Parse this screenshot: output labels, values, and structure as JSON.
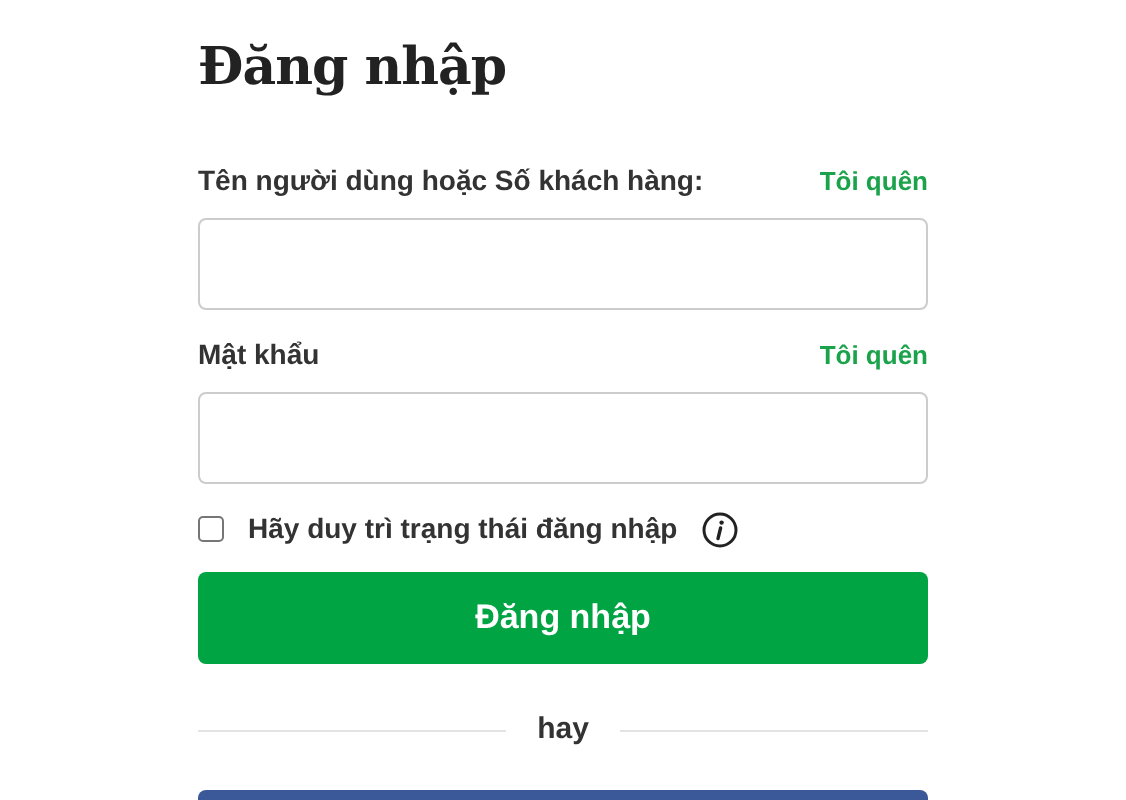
{
  "title": "Đăng nhập",
  "fields": [
    {
      "label": "Tên người dùng hoặc Số khách hàng:",
      "link": "Tôi quên"
    },
    {
      "label": "Mật khẩu",
      "link": "Tôi quên"
    }
  ],
  "remember": {
    "label": "Hãy duy trì trạng thái đăng nhập",
    "checked": false
  },
  "submit": "Đăng nhập",
  "divider": "hay"
}
